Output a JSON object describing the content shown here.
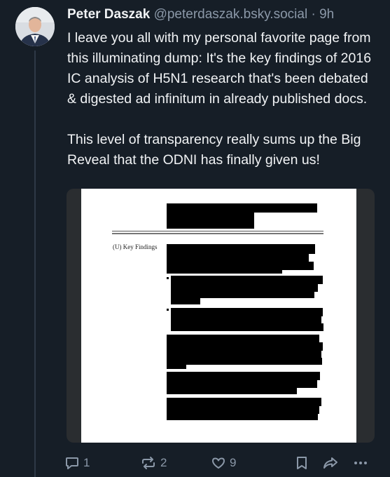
{
  "post": {
    "author": "Peter Daszak",
    "handle": "@peterdaszak.bsky.social",
    "separator": "·",
    "time": "9h",
    "text": "I leave you all with my personal favorite page from this illuminating dump: It's the key findings of 2016 IC analysis of H5N1 research that's been debated & digested ad infinitum in already published docs.\n\nThis level of transparency really sums up the Big Reveal that the ODNI has finally given us!"
  },
  "document": {
    "section_label": "(U) Key Findings"
  },
  "actions": {
    "reply_count": "1",
    "repost_count": "2",
    "like_count": "9"
  },
  "icons": [
    "reply-icon",
    "repost-icon",
    "like-icon",
    "bookmark-icon",
    "share-icon",
    "more-icon"
  ],
  "colors": {
    "background": "#161e27",
    "text": "#f1f3f5",
    "muted": "#8b98a8"
  }
}
